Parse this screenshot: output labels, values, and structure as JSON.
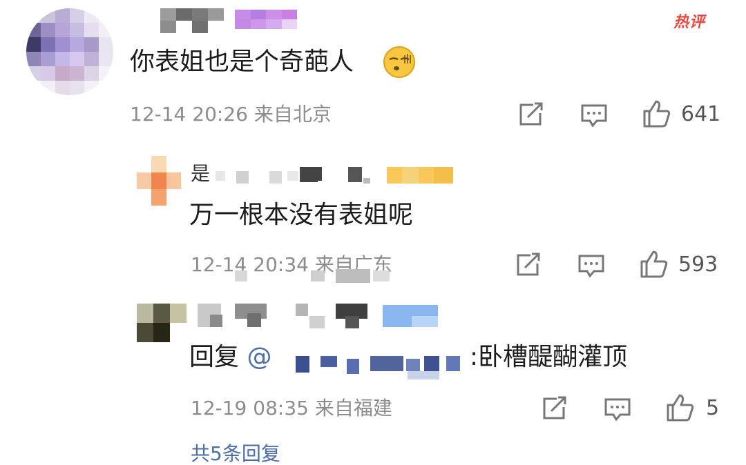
{
  "header": {
    "badge": "热评"
  },
  "comments": [
    {
      "text": "你表姐也是个奇葩人",
      "emoji": "sleepy-face-emoji",
      "time": "12-14 20:26",
      "location": "来自北京",
      "likes": "641"
    },
    {
      "text": "万一根本没有表姐呢",
      "time": "12-14 20:34",
      "location": "来自广东",
      "likes": "593"
    },
    {
      "reply_prefix": "回复",
      "mention_at": "@",
      "text": ":卧槽醍醐灌顶",
      "time": "12-19 08:35",
      "location": "来自福建",
      "likes": "5"
    }
  ],
  "footer": {
    "more_replies": "共5条回复"
  },
  "icons": {
    "share": "share-icon",
    "comment": "comment-icon",
    "like": "like-icon"
  }
}
